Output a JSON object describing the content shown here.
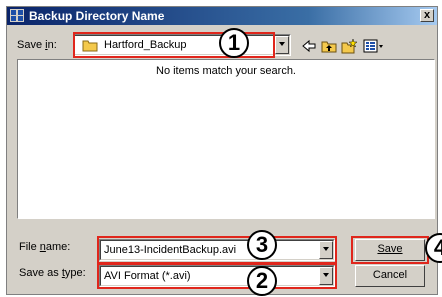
{
  "dialog": {
    "title": "Backup Directory Name",
    "close_label": "x"
  },
  "save_in": {
    "label": "Save in:",
    "folder": "Hartford_Backup"
  },
  "file_list": {
    "empty_message": "No items match your search."
  },
  "file_name": {
    "label": "File name:",
    "value": "June13-IncidentBackup.avi"
  },
  "save_as_type": {
    "label": "Save as type:",
    "value": "AVI Format (*.avi)"
  },
  "buttons": {
    "save": "Save",
    "cancel": "Cancel"
  },
  "callouts": {
    "one": "1",
    "two": "2",
    "three": "3",
    "four": "4"
  },
  "icons": [
    "app-icon",
    "folder-icon",
    "back-arrow-icon",
    "up-folder-icon",
    "new-folder-icon",
    "view-menu-icon"
  ],
  "colors": {
    "highlight": "#e0261c",
    "titlebar": "#0a246a"
  }
}
